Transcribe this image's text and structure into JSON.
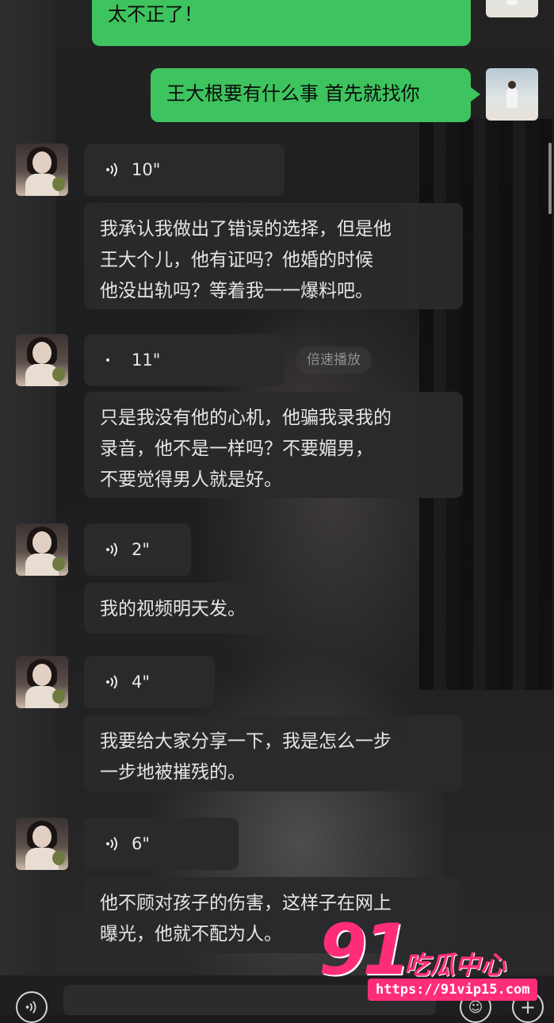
{
  "chat": {
    "outgoing": [
      {
        "text": "太不正了！"
      },
      {
        "text": "王大根要有什么事 首先就找你"
      }
    ],
    "incoming": [
      {
        "voice_duration": "10\"",
        "transcript": [
          "我承认我做出了错误的选择，但是他",
          "王大个儿，他有证吗？他婚的时候",
          "他没出轨吗？等着我一一爆料吧。"
        ]
      },
      {
        "voice_duration": "11\"",
        "transcript": [
          "只是我没有他的心机，他骗我录我的",
          "录音，他不是一样吗？不要媚男，",
          "不要觉得男人就是好。"
        ]
      },
      {
        "voice_duration": "2\"",
        "transcript": [
          "我的视频明天发。"
        ]
      },
      {
        "voice_duration": "4\"",
        "transcript": [
          "我要给大家分享一下，我是怎么一步",
          "一步地被摧残的。"
        ]
      },
      {
        "voice_duration": "6\"",
        "transcript": [
          "他不顾对孩子的伤害，这样子在网上",
          "曝光，他就不配为人。"
        ]
      }
    ],
    "speed_play_label": "倍速播放"
  },
  "input_bar": {
    "voice_icon": "voice-wave-icon",
    "emoji_icon": "emoji-icon",
    "plus_icon": "plus-icon"
  },
  "watermark": {
    "number": "91",
    "name": "吃瓜中心",
    "url": "https://91vip15.com"
  },
  "colors": {
    "outgoing_bubble": "#3ec45e",
    "incoming_bubble": "#2a2a2c",
    "watermark": "#ff2d78"
  }
}
